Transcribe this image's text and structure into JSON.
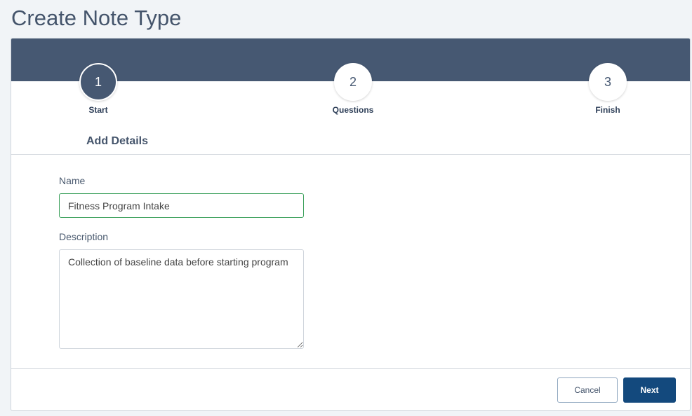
{
  "page": {
    "title": "Create Note Type"
  },
  "steps": [
    {
      "number": "1",
      "label": "Start"
    },
    {
      "number": "2",
      "label": "Questions"
    },
    {
      "number": "3",
      "label": "Finish"
    }
  ],
  "active_step": 1,
  "section": {
    "title": "Add Details"
  },
  "form": {
    "name_label": "Name",
    "name_value": "Fitness Program Intake",
    "description_label": "Description",
    "description_value": "Collection of baseline data before starting program"
  },
  "actions": {
    "cancel_label": "Cancel",
    "next_label": "Next"
  },
  "colors": {
    "header": "#465872",
    "primary_button": "#13497d",
    "focus_border": "#3aa05a",
    "title_text": "#44546b"
  }
}
